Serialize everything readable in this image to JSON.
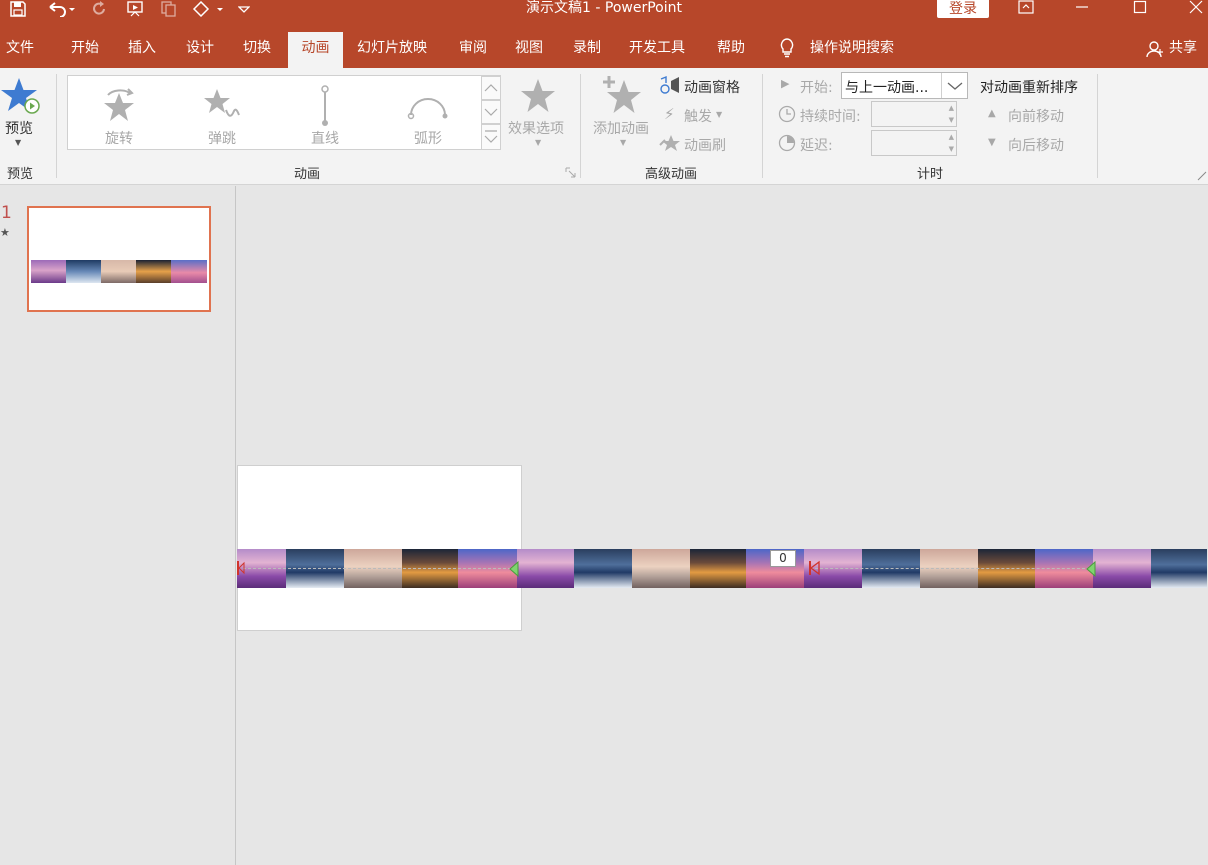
{
  "app": {
    "doc_title": "演示文稿1  -  PowerPoint",
    "login_label": "登录"
  },
  "tabs": [
    {
      "label": "文件"
    },
    {
      "label": "开始"
    },
    {
      "label": "插入"
    },
    {
      "label": "设计"
    },
    {
      "label": "切换"
    },
    {
      "label": "动画",
      "active": true
    },
    {
      "label": "幻灯片放映"
    },
    {
      "label": "审阅"
    },
    {
      "label": "视图"
    },
    {
      "label": "录制"
    },
    {
      "label": "开发工具"
    },
    {
      "label": "帮助"
    }
  ],
  "tell_me": {
    "label": "操作说明搜索"
  },
  "share": {
    "label": "共享"
  },
  "ribbon": {
    "preview": {
      "button_label": "预览",
      "group_label": "预览"
    },
    "animation": {
      "group_label": "动画",
      "items": [
        {
          "label": "旋转",
          "icon": "spin-star-icon"
        },
        {
          "label": "弹跳",
          "icon": "bounce-star-icon"
        },
        {
          "label": "直线",
          "icon": "line-path-icon"
        },
        {
          "label": "弧形",
          "icon": "arc-path-icon"
        }
      ],
      "effect_options_label": "效果选项"
    },
    "advanced": {
      "group_label": "高级动画",
      "add_animation_label": "添加动画",
      "animation_pane_label": "动画窗格",
      "trigger_label": "触发",
      "painter_label": "动画刷"
    },
    "timing": {
      "group_label": "计时",
      "start_label": "开始:",
      "start_value": "与上一动画...",
      "duration_label": "持续时间:",
      "delay_label": "延迟:",
      "reorder_title": "对动画重新排序",
      "move_earlier_label": "向前移动",
      "move_later_label": "向后移动"
    }
  },
  "thumbnails": [
    {
      "number": "1",
      "has_animation": true
    }
  ],
  "slide": {
    "animation_badge": "0"
  },
  "colors": {
    "accent": "#b7472a",
    "thumb_border": "#e0734f"
  }
}
